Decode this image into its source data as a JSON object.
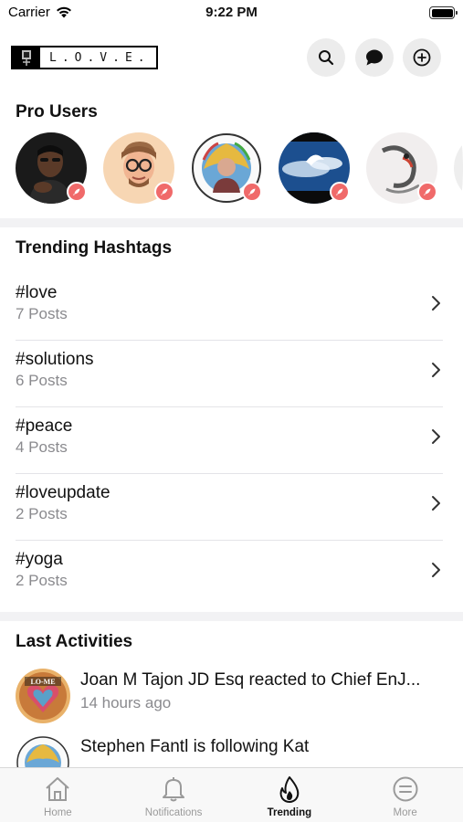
{
  "status_bar": {
    "carrier": "Carrier",
    "time": "9:22 PM",
    "battery_level": 0.9
  },
  "header": {
    "logo_text": "L.O.V.E.",
    "icons": [
      "search-icon",
      "chat-bubble-icon",
      "add-circle-icon"
    ]
  },
  "pro_users": {
    "title": "Pro Users",
    "users": [
      {
        "avatar": "man-portrait",
        "badge_icon": "rocket-icon"
      },
      {
        "avatar": "memoji-glasses",
        "badge_icon": "rocket-icon"
      },
      {
        "avatar": "world-institute-for-peace-seal",
        "badge_icon": "rocket-icon"
      },
      {
        "avatar": "sky-angel",
        "badge_icon": "rocket-icon"
      },
      {
        "avatar": "ink-dragon-art",
        "badge_icon": "rocket-icon"
      }
    ]
  },
  "trending_hashtags": {
    "title": "Trending Hashtags",
    "items": [
      {
        "tag": "#love",
        "count": "7 Posts"
      },
      {
        "tag": "#solutions",
        "count": "6 Posts"
      },
      {
        "tag": "#peace",
        "count": "4 Posts"
      },
      {
        "tag": "#loveupdate",
        "count": "2 Posts"
      },
      {
        "tag": "#yoga",
        "count": "2 Posts"
      }
    ]
  },
  "last_activities": {
    "title": "Last Activities",
    "items": [
      {
        "text": "Joan M Tajon JD Esq reacted to Chief EnJ...",
        "time": "14 hours ago",
        "avatar_text": "LO-ME"
      },
      {
        "text": "Stephen Fantl is following Kat",
        "time": "",
        "avatar_text": ""
      }
    ]
  },
  "tab_bar": {
    "tabs": [
      {
        "label": "Home",
        "icon": "home-icon",
        "active": false
      },
      {
        "label": "Notifications",
        "icon": "bell-icon",
        "active": false
      },
      {
        "label": "Trending",
        "icon": "flame-icon",
        "active": true
      },
      {
        "label": "More",
        "icon": "menu-circle-icon",
        "active": false
      }
    ]
  },
  "colors": {
    "pro_badge": "#f06a6a",
    "band": "#f2f2f4",
    "secondary_text": "#8a8a8e"
  }
}
